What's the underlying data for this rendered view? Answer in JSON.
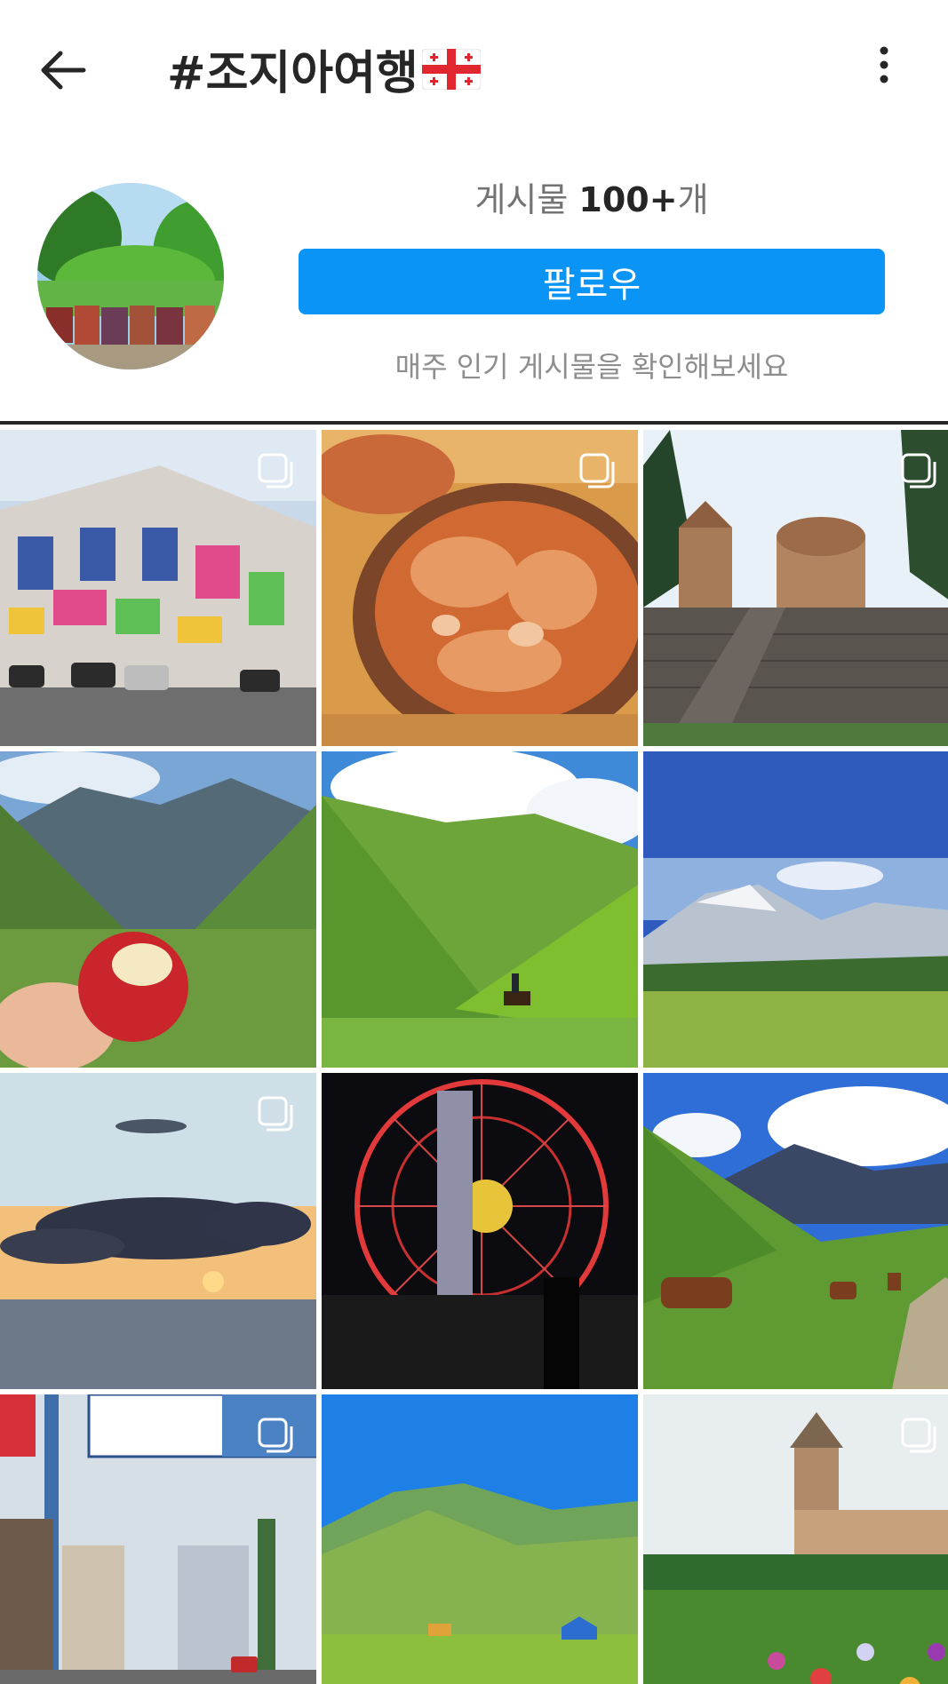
{
  "header": {
    "title": "#조지아여행",
    "posts_prefix": "게시물 ",
    "posts_count": "100+",
    "posts_suffix": "개",
    "follow_label": "팔로우",
    "hint": "매주 인기 게시물을 확인해보세요"
  },
  "icons": {
    "back": "arrow-left-icon",
    "more": "more-vertical-icon",
    "flag": "georgia-flag-icon",
    "multi": "multiple-posts-icon"
  },
  "colors": {
    "accent": "#0a95f6",
    "text": "#262626",
    "muted": "#8e8e8e"
  },
  "grid": {
    "tiles": [
      {
        "subject": "graffiti-building",
        "multi": true
      },
      {
        "subject": "stew-dish",
        "multi": true
      },
      {
        "subject": "stone-church",
        "multi": true
      },
      {
        "subject": "apple-mountains",
        "multi": false
      },
      {
        "subject": "green-valley-horse",
        "multi": false
      },
      {
        "subject": "snowy-mountains",
        "multi": false
      },
      {
        "subject": "sunset-sea",
        "multi": true
      },
      {
        "subject": "ferris-wheel-night",
        "multi": false
      },
      {
        "subject": "horses-meadow",
        "multi": false
      },
      {
        "subject": "city-street",
        "multi": true
      },
      {
        "subject": "green-hills-tents",
        "multi": false
      },
      {
        "subject": "church-garden",
        "multi": true
      }
    ]
  }
}
